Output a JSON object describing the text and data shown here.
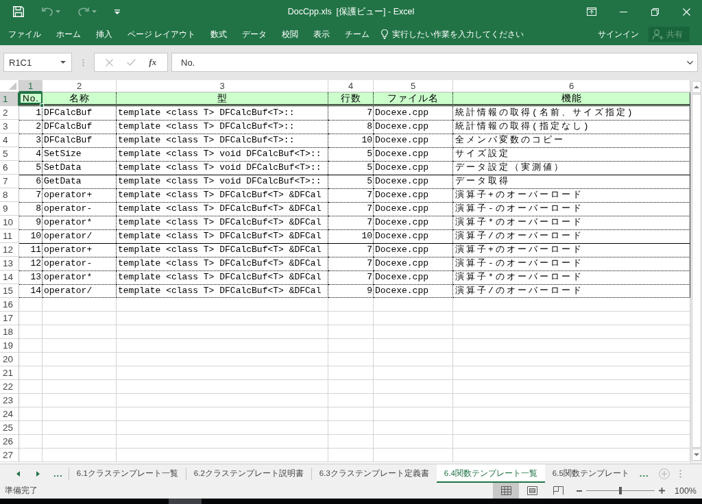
{
  "title_bar": {
    "title": "DocCpp.xls  [保護ビュー] - Excel",
    "quick_access": [
      {
        "kind": "save",
        "disabled": false
      },
      {
        "kind": "undo",
        "disabled": true
      },
      {
        "kind": "redo",
        "disabled": true
      },
      {
        "kind": "customize",
        "disabled": false
      }
    ]
  },
  "ribbon": {
    "tabs": [
      {
        "label": "ファイル",
        "selected": false
      },
      {
        "label": "ホーム",
        "selected": false
      },
      {
        "label": "挿入",
        "selected": false
      },
      {
        "label": "ページ レイアウト",
        "selected": false
      },
      {
        "label": "数式",
        "selected": false
      },
      {
        "label": "データ",
        "selected": false
      },
      {
        "label": "校閲",
        "selected": false
      },
      {
        "label": "表示",
        "selected": false
      },
      {
        "label": "チーム",
        "selected": false
      }
    ],
    "tell_me": {
      "placeholder": "実行したい作業を入力してください"
    },
    "sign_in": "サインイン",
    "share": {
      "label": "共有",
      "disabled": true
    }
  },
  "formula_bar": {
    "name_box": "R1C1",
    "buttons": [
      {
        "kind": "cancel",
        "disabled": true
      },
      {
        "kind": "enter",
        "disabled": true
      },
      {
        "kind": "function",
        "label": "fx",
        "disabled": false
      }
    ],
    "value": "No."
  },
  "sheet": {
    "column_headers": [
      {
        "label": "1",
        "selected": true
      },
      {
        "label": "2",
        "selected": false
      },
      {
        "label": "3",
        "selected": false
      },
      {
        "label": "4",
        "selected": false
      },
      {
        "label": "5",
        "selected": false
      },
      {
        "label": "6",
        "selected": false
      }
    ],
    "header_row": {
      "number": {
        "label": "1",
        "selected": true
      },
      "cells": [
        {
          "text": "No.",
          "selected": true
        },
        {
          "text": "名称",
          "selected": false
        },
        {
          "text": "型",
          "selected": false
        },
        {
          "text": "行数",
          "selected": false
        },
        {
          "text": "ファイル名",
          "selected": false
        },
        {
          "text": "機能",
          "selected": false
        }
      ]
    },
    "rows": [
      {
        "number": "2",
        "separator_above": false,
        "cells": [
          "1",
          "DFCalcBuf",
          "template <class T> DFCalcBuf<T>::",
          "7",
          "Docexe.cpp",
          "統計情報の取得(名前、サイズ指定)"
        ]
      },
      {
        "number": "3",
        "separator_above": false,
        "cells": [
          "2",
          "DFCalcBuf",
          "template <class T> DFCalcBuf<T>::",
          "8",
          "Docexe.cpp",
          "統計情報の取得(指定なし)"
        ]
      },
      {
        "number": "4",
        "separator_above": false,
        "cells": [
          "3",
          "DFCalcBuf",
          "template <class T> DFCalcBuf<T>::",
          "10",
          "Docexe.cpp",
          "全メンバ変数のコピー"
        ]
      },
      {
        "number": "5",
        "separator_above": false,
        "cells": [
          "4",
          "SetSize",
          "template <class T> void DFCalcBuf<T>::",
          "5",
          "Docexe.cpp",
          "サイズ設定"
        ]
      },
      {
        "number": "6",
        "separator_above": false,
        "cells": [
          "5",
          "SetData",
          "template <class T> void DFCalcBuf<T>::",
          "5",
          "Docexe.cpp",
          "データ設定（実測値）"
        ]
      },
      {
        "number": "7",
        "separator_above": true,
        "cells": [
          "6",
          "GetData",
          "template <class T> void DFCalcBuf<T>::",
          "5",
          "Docexe.cpp",
          "データ取得"
        ]
      },
      {
        "number": "8",
        "separator_above": false,
        "cells": [
          "7",
          "operator+",
          "template <class T> DFCalcBuf<T> &DFCal",
          "7",
          "Docexe.cpp",
          "演算子+のオーバーロード"
        ]
      },
      {
        "number": "9",
        "separator_above": false,
        "cells": [
          "8",
          "operator-",
          "template <class T> DFCalcBuf<T> &DFCal",
          "7",
          "Docexe.cpp",
          "演算子-のオーバーロード"
        ]
      },
      {
        "number": "10",
        "separator_above": false,
        "cells": [
          "9",
          "operator*",
          "template <class T> DFCalcBuf<T> &DFCal",
          "7",
          "Docexe.cpp",
          "演算子*のオーバーロード"
        ]
      },
      {
        "number": "11",
        "separator_above": false,
        "cells": [
          "10",
          "operator/",
          "template <class T> DFCalcBuf<T> &DFCal",
          "10",
          "Docexe.cpp",
          "演算子/のオーバーロード"
        ]
      },
      {
        "number": "12",
        "separator_above": true,
        "cells": [
          "11",
          "operator+",
          "template <class T> DFCalcBuf<T> &DFCal",
          "7",
          "Docexe.cpp",
          "演算子+のオーバーロード"
        ]
      },
      {
        "number": "13",
        "separator_above": false,
        "cells": [
          "12",
          "operator-",
          "template <class T> DFCalcBuf<T> &DFCal",
          "7",
          "Docexe.cpp",
          "演算子-のオーバーロード"
        ]
      },
      {
        "number": "14",
        "separator_above": false,
        "cells": [
          "13",
          "operator*",
          "template <class T> DFCalcBuf<T> &DFCal",
          "7",
          "Docexe.cpp",
          "演算子*のオーバーロード"
        ]
      },
      {
        "number": "15",
        "separator_above": false,
        "cells": [
          "14",
          "operator/",
          "template <class T> DFCalcBuf<T> &DFCal",
          "9",
          "Docexe.cpp",
          "演算子/のオーバーロード"
        ]
      }
    ],
    "empty_rows": [
      "16",
      "17",
      "18",
      "19",
      "20",
      "21",
      "22",
      "23",
      "24",
      "25",
      "26",
      "27"
    ]
  },
  "sheet_tabs": {
    "more_left": "...",
    "tabs": [
      {
        "label": "6.1クラステンプレート一覧",
        "selected": false
      },
      {
        "label": "6.2クラステンプレート説明書",
        "selected": false
      },
      {
        "label": "6.3クラステンプレート定義書",
        "selected": false
      },
      {
        "label": "6.4関数テンプレート一覧",
        "selected": true
      },
      {
        "label": "6.5関数テンプレート",
        "selected": false
      }
    ],
    "more_right": "..."
  },
  "status_bar": {
    "status": "準備完了",
    "views": [
      {
        "kind": "normal",
        "selected": true
      },
      {
        "kind": "page_layout",
        "selected": false
      },
      {
        "kind": "page_break",
        "selected": false
      }
    ],
    "zoom": {
      "level": 0.5,
      "reading": "100%"
    }
  }
}
